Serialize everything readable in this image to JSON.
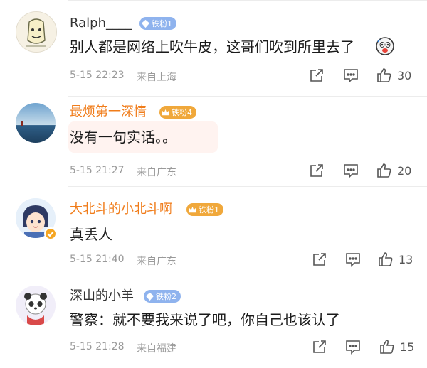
{
  "comments": [
    {
      "name": "Ralph____",
      "badge": "铁粉1",
      "text": "别人都是网络上吹牛皮，这哥们吹到所里去了",
      "time": "5-15 22:23",
      "location": "来自上海",
      "likes": "30"
    },
    {
      "name": "最烦第一深情",
      "badge": "铁粉4",
      "text": "没有一句实话。。",
      "time": "5-15 21:27",
      "location": "来自广东",
      "likes": "20"
    },
    {
      "name": "大北斗的小北斗啊",
      "badge": "铁粉1",
      "text": "真丢人",
      "time": "5-15 21:40",
      "location": "来自广东",
      "likes": "13"
    },
    {
      "name": "深山的小羊",
      "badge": "铁粉2",
      "text": "警察：就不要我来说了吧，你自己也该认了",
      "time": "5-15 21:28",
      "location": "来自福建",
      "likes": "15"
    }
  ],
  "colors": {
    "vip_name": "#f07c1a",
    "badge_blue": "#8fb3ee",
    "badge_gold": "#f0a83b",
    "meta_gray": "#9a9a9a"
  },
  "icons": [
    "share-icon",
    "comment-icon",
    "like-icon",
    "laugh-emoji-icon",
    "verified-icon"
  ]
}
